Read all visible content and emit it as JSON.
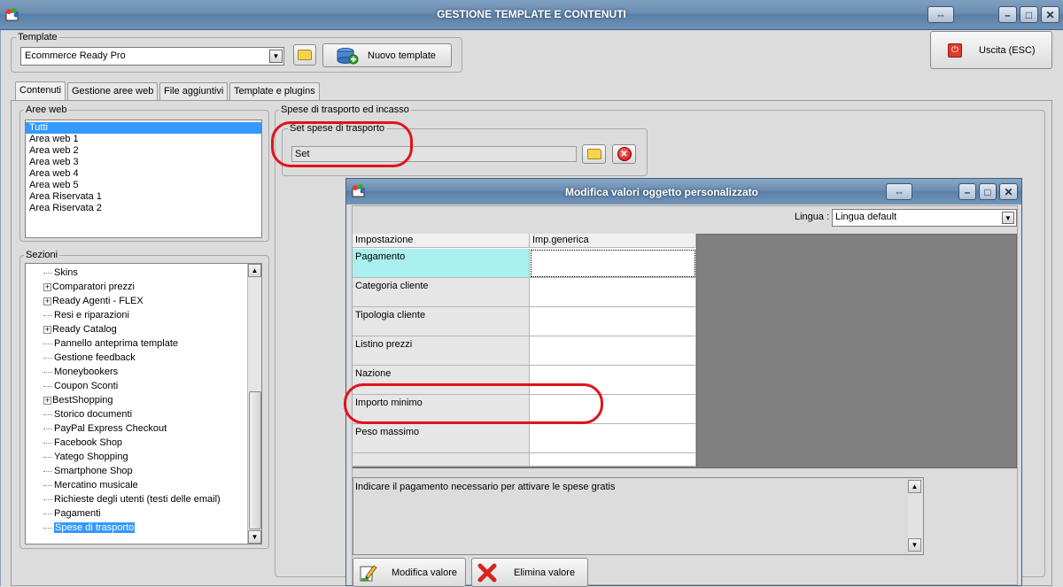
{
  "window": {
    "title": "GESTIONE TEMPLATE E CONTENUTI",
    "exit_label": "Uscita (ESC)"
  },
  "template": {
    "group_label": "Template",
    "selected": "Ecommerce Ready Pro",
    "new_button": "Nuovo template"
  },
  "tabs": [
    {
      "label": "Contenuti",
      "active": true
    },
    {
      "label": "Gestione aree web",
      "active": false
    },
    {
      "label": "File aggiuntivi",
      "active": false
    },
    {
      "label": "Template e plugins",
      "active": false
    }
  ],
  "aree_web": {
    "label": "Aree web",
    "items": [
      "Tutti",
      "Area web 1",
      "Area web 2",
      "Area web 3",
      "Area web 4",
      "Area web 5",
      "Area Riservata 1",
      "Area Riservata 2"
    ],
    "selected_index": 0
  },
  "sezioni": {
    "label": "Sezioni",
    "items": [
      {
        "label": "Skins",
        "expandable": false
      },
      {
        "label": "Comparatori prezzi",
        "expandable": true
      },
      {
        "label": "Ready Agenti - FLEX",
        "expandable": true
      },
      {
        "label": "Resi e riparazioni",
        "expandable": false
      },
      {
        "label": "Ready Catalog",
        "expandable": true
      },
      {
        "label": "Pannello anteprima template",
        "expandable": false
      },
      {
        "label": "Gestione feedback",
        "expandable": false
      },
      {
        "label": "Moneybookers",
        "expandable": false
      },
      {
        "label": "Coupon Sconti",
        "expandable": false
      },
      {
        "label": "BestShopping",
        "expandable": true
      },
      {
        "label": "Storico documenti",
        "expandable": false
      },
      {
        "label": "PayPal Express Checkout",
        "expandable": false
      },
      {
        "label": "Facebook Shop",
        "expandable": false
      },
      {
        "label": "Yatego Shopping",
        "expandable": false
      },
      {
        "label": "Smartphone Shop",
        "expandable": false
      },
      {
        "label": "Mercatino musicale",
        "expandable": false
      },
      {
        "label": "Richieste degli utenti (testi delle email)",
        "expandable": false
      },
      {
        "label": "Pagamenti",
        "expandable": false
      },
      {
        "label": "Spese di trasporto",
        "expandable": false
      }
    ],
    "selected_index": 18
  },
  "spese": {
    "group_label": "Spese di trasporto ed incasso",
    "set_label": "Set spese di trasporto",
    "set_value": "Set"
  },
  "dialog": {
    "title": "Modifica valori oggetto personalizzato",
    "lingua_label": "Lingua :",
    "lingua_value": "Lingua default",
    "grid": {
      "headers": [
        "Impostazione",
        "Imp.generica"
      ],
      "rows": [
        "Pagamento",
        "Categoria cliente",
        "Tipologia cliente",
        "Listino prezzi",
        "Nazione",
        "Importo minimo",
        "Peso massimo"
      ]
    },
    "description": "Indicare il pagamento necessario per attivare le spese gratis",
    "modify_button": "Modifica valore",
    "delete_button": "Elimina valore"
  },
  "colors": {
    "selection": "#3399ff",
    "annotation": "#e0121d",
    "grid_highlight": "#aaf0f0",
    "dark_area": "#808080"
  }
}
